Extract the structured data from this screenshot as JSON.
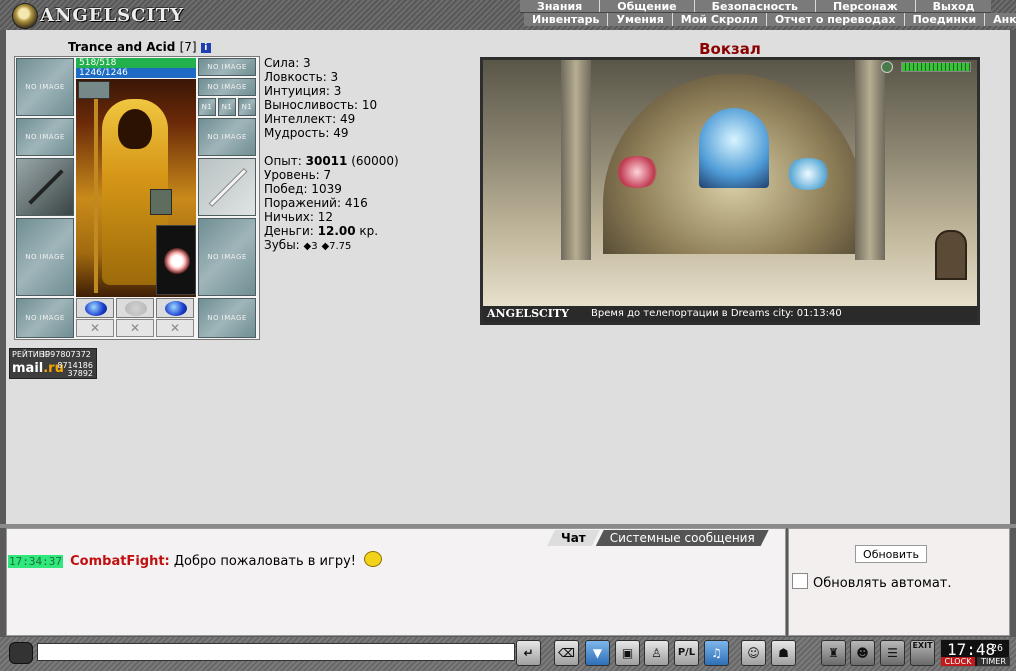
{
  "app": {
    "logo_text": "ANGELSCITY"
  },
  "menu": {
    "primary": [
      "Знания",
      "Общение",
      "Безопасность",
      "Персонаж",
      "Выход"
    ],
    "secondary": [
      "Инвентарь",
      "Умения",
      "Мой Скролл",
      "Отчет о переводах",
      "Поединки",
      "Анкета"
    ]
  },
  "character": {
    "name": "Trance and Acid",
    "level_display": "[7]",
    "info_icon": "i",
    "hp": "518/518",
    "mana": "1246/1246",
    "empty_slot_label": "NO IMAGE",
    "ring_label": "N1"
  },
  "stats": {
    "strength": "Сила: 3",
    "agility": "Ловкость: 3",
    "intuition": "Интуиция: 3",
    "endurance": "Выносливость: 10",
    "intellect": "Интеллект: 49",
    "wisdom": "Мудрость: 49",
    "exp_label": "Опыт: ",
    "exp_value": "30011",
    "exp_next": " (60000)",
    "level": "Уровень: 7",
    "wins": "Побед: 1039",
    "losses": "Поражений: 416",
    "draws": "Ничьих: 12",
    "money_label": "Деньги: ",
    "money_value": "12.00",
    "money_unit": " кр.",
    "teeth_label": "Зубы: ",
    "teeth_a": "3",
    "teeth_b": "7.75"
  },
  "rating": {
    "label": "РЕЙТИНГ",
    "total": "3997807372",
    "brand_a": "mail",
    "brand_b": ".ru",
    "n1": "8714186",
    "n2": "37892"
  },
  "location": {
    "title": "Вокзал",
    "footer_brand": "ANGELSCITY",
    "teleport_text": "Время до телепортации в Dreams city: 01:13:40",
    "gauge_fraction": 1.0
  },
  "chat": {
    "tabs": [
      "Чат",
      "Системные сообщения"
    ],
    "time": "17:34:37",
    "nick": "CombatFight:",
    "message": "Добро пожаловать в игру!"
  },
  "refresh": {
    "button": "Обновить",
    "auto_label": "Обновлять автомат."
  },
  "toolbar": {
    "p_label": "P/L"
  },
  "clock": {
    "time": "17:48",
    "seconds": "26",
    "clock_label": "CLOCK",
    "timer_label": "TIMER",
    "exit_label": "EXIT"
  },
  "colors": {
    "location_title": "#8b0000",
    "hp_bar": "#22b14c",
    "mana_bar": "#1d6bc4",
    "chat_nick": "#c01010",
    "chat_time_bg": "#2ee87c"
  }
}
